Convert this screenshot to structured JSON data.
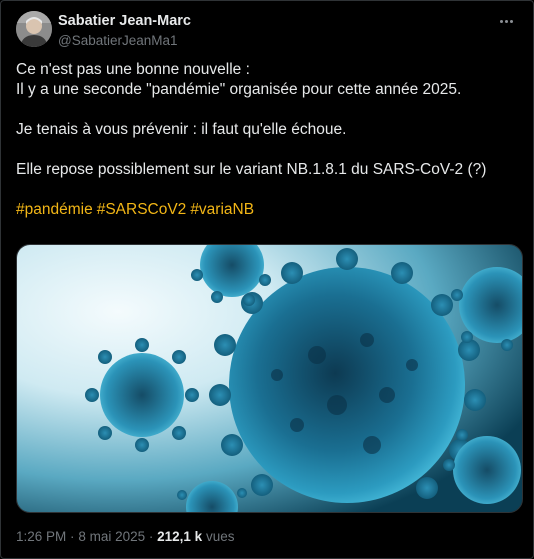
{
  "author": {
    "display_name": "Sabatier Jean-Marc",
    "handle": "@SabatierJeanMa1",
    "avatar_icon": "avatar-photo"
  },
  "more_icon": "more-options-icon",
  "tweet": {
    "lines": [
      "Ce n'est pas une bonne nouvelle :",
      "Il y a une seconde \"pandémie\" organisée pour cette année 2025.",
      "Je tenais à vous prévenir : il faut qu'elle échoue.",
      "Elle repose possiblement sur le variant NB.1.8.1 du SARS-CoV-2 (?)"
    ],
    "hashtags": [
      "#pandémie",
      "#SARSCoV2",
      "#variaNB"
    ]
  },
  "media": {
    "description_icon": "virus-image"
  },
  "meta": {
    "time": "1:26 PM",
    "separator": "·",
    "date": "8 mai 2025",
    "separator2": "·",
    "views_count": "212,1 k",
    "views_label": "vues"
  },
  "colors": {
    "background": "#000000",
    "text": "#e7e9ea",
    "muted": "#71767b",
    "hashtag": "#f2b616"
  }
}
